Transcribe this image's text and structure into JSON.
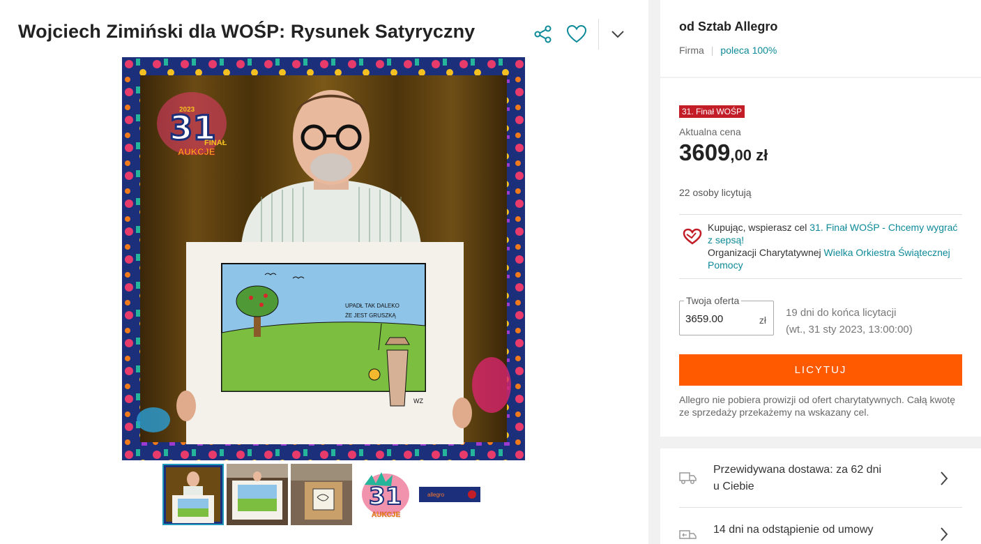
{
  "title": "Wojciech Zimiński dla WOŚP: Rysunek Satyryczny",
  "actions": {
    "share_icon": "share-icon",
    "favorite_icon": "heart-outline-icon",
    "more_icon": "chevron-down-icon"
  },
  "gallery": {
    "cartoon_caption": [
      "UPADŁ TAK DALEKO",
      "ŻE JEST GRUSZKĄ"
    ],
    "cartoon_signature": "WZ",
    "logo": {
      "number": "31",
      "line1": "FINAŁ",
      "line2": "AUKCJE",
      "year": "2023"
    },
    "banner_text": "allegro"
  },
  "seller": {
    "name": "od Sztab Allegro",
    "type": "Firma",
    "recommend": "poleca 100%"
  },
  "offer": {
    "badge": "31. Finał WOŚP",
    "price_label": "Aktualna cena",
    "price_int": "3609",
    "price_dec": ",00 zł",
    "bidders": "22 osoby licytują",
    "charity_prefix": "Kupując, wspierasz cel ",
    "charity_goal": "31. Finał WOŚP - Chcemy wygrać z sepsą!",
    "charity_org_prefix": "Organizacji Charytatywnej ",
    "charity_org": "Wielka Orkiestra Świątecznej Pomocy",
    "bid_label": "Twoja oferta",
    "bid_value": "3659.00",
    "bid_unit": "zł",
    "days_left": "19 dni do końca licytacji",
    "end_date": "(wt., 31 sty 2023, 13:00:00)",
    "button": "LICYTUJ",
    "note": "Allegro nie pobiera prowizji od ofert charytatywnych. Całą kwotę ze sprzedaży przekażemy na wskazany cel."
  },
  "delivery": {
    "line1": "Przewidywana dostawa: za 62 dni",
    "line2": "u Ciebie",
    "returns": "14 dni na odstąpienie od umowy"
  },
  "colors": {
    "accent_teal": "#0d8a98",
    "button_orange": "#ff5a00",
    "badge_red": "#c31d27"
  }
}
